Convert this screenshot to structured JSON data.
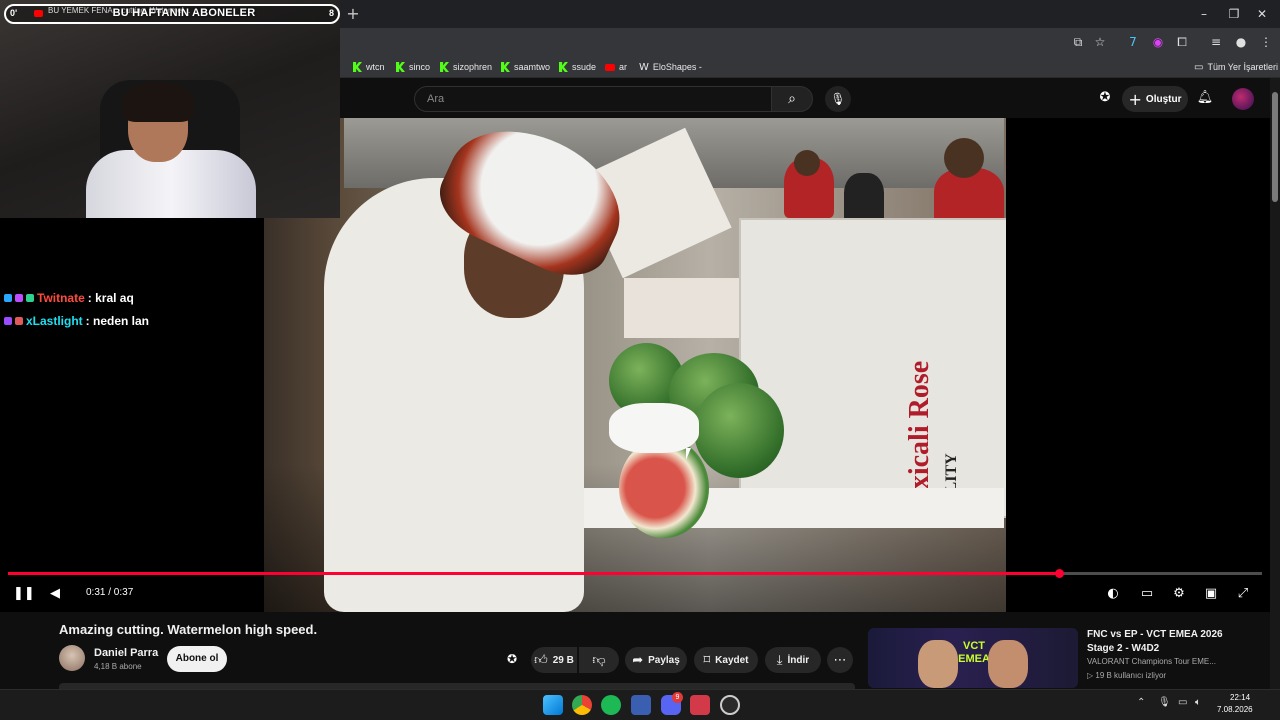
{
  "browser": {
    "tab_title": "BU YEMEK FENA... cutting. Watermel...",
    "bookmarks": [
      {
        "label": "wtcn",
        "icon": "kick-icon"
      },
      {
        "label": "sinco",
        "icon": "kick-icon"
      },
      {
        "label": "sizophren",
        "icon": "kick-icon"
      },
      {
        "label": "saamtwo",
        "icon": "kick-icon"
      },
      {
        "label": "ssude",
        "icon": "kick-icon"
      },
      {
        "label": "ar",
        "icon": "youtube-icon"
      },
      {
        "label": "EloShapes -",
        "icon": "eloshapes-icon"
      }
    ],
    "all_bookmarks_label": "Tüm Yer İşaretleri"
  },
  "youtube": {
    "search_placeholder": "Ara",
    "create_label": "Oluştur"
  },
  "stream_overlay": {
    "banner": "BU HAFTANIN ABONELER",
    "left_text": "0'",
    "right_text": "8",
    "chat": [
      {
        "user": "Twitnate",
        "message": ": kral aq",
        "user_color": "#ff4b3e"
      },
      {
        "user": "xLastlight",
        "message": ": neden lan",
        "user_color": "#1fe0f0"
      }
    ]
  },
  "player": {
    "current_time": "0:31",
    "duration": "0:37",
    "time_text": "0:31 / 0:37",
    "progress_fraction": 0.838,
    "accent_color": "#ff0033"
  },
  "video": {
    "title": "Amazing cutting. Watermelon high speed.",
    "channel_name": "Daniel Parra",
    "subscriber_count": "4,18 B abone",
    "subscribe_label": "Abone ol",
    "likes": "29 B",
    "share_label": "Paylaş",
    "save_label": "Kaydet",
    "download_label": "İndir",
    "frame_box_text": "Mexicali Rose",
    "frame_box_quality": "QUALITY"
  },
  "suggested": {
    "title": "FNC vs EP - VCT EMEA 2026 Stage 2 - W4D2",
    "channel": "VALORANT Champions Tour EME...",
    "viewers": "▷ 19 B kullanıcı izliyor",
    "thumb_logo": "VCT EMEA"
  },
  "taskbar": {
    "time": "22:14",
    "date": "7.08.2026",
    "discord_badge": "9"
  }
}
